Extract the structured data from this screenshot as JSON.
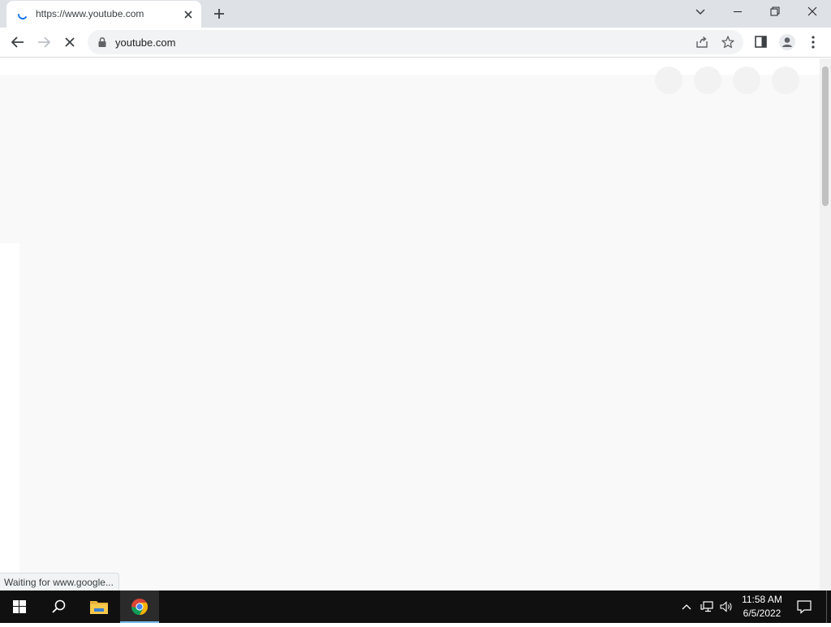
{
  "browser": {
    "tab": {
      "title": "https://www.youtube.com"
    },
    "address_bar": {
      "url": "youtube.com"
    },
    "status_bubble": "Waiting for www.google..."
  },
  "icons": {
    "tab_spinner": "loading-spinner-icon",
    "tab_close": "close-icon",
    "new_tab": "plus-icon",
    "tab_search": "chevron-down-icon",
    "window_minimize": "minimize-icon",
    "window_restore": "restore-icon",
    "window_close": "close-icon",
    "back": "arrow-left-icon",
    "forward": "arrow-right-icon",
    "stop": "x-icon",
    "lock": "lock-icon",
    "share": "share-icon",
    "bookmark": "star-icon",
    "side_panel": "side-panel-icon",
    "profile": "profile-icon",
    "menu": "kebab-menu-icon",
    "start": "windows-logo-icon",
    "search": "search-icon",
    "file_explorer": "folder-icon",
    "chrome": "chrome-icon",
    "tray_overflow": "chevron-up-icon",
    "network": "network-icon",
    "volume": "volume-icon",
    "notifications": "notification-icon"
  },
  "taskbar": {
    "clock": {
      "time": "11:58 AM",
      "date": "6/5/2022"
    }
  },
  "colors": {
    "tabstrip_bg": "#dee1e6",
    "omnibox_bg": "#f1f3f4",
    "page_bg": "#f9f9f9",
    "taskbar_bg": "#101010",
    "accent_spinner": "#1a73e8",
    "active_app_bar": "#76b9ed"
  }
}
